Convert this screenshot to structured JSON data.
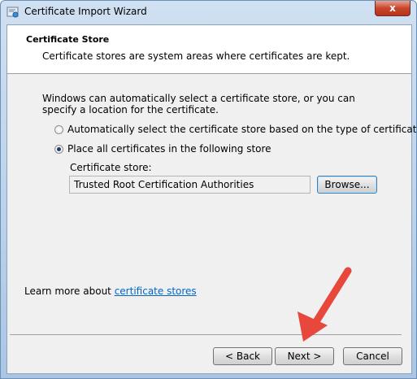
{
  "window": {
    "title": "Certificate Import Wizard",
    "close_glyph": "x"
  },
  "header": {
    "title": "Certificate Store",
    "subtitle": "Certificate stores are system areas where certificates are kept."
  },
  "body": {
    "intro": "Windows can automatically select a certificate store, or you can specify a location for the certificate.",
    "option_auto": "Automatically select the certificate store based on the type of certificate",
    "option_manual": "Place all certificates in the following store",
    "selected_option": "option_manual",
    "store_label": "Certificate store:",
    "store_value": "Trusted Root Certification Authorities",
    "browse_label": "Browse...",
    "learn_prefix": "Learn more about ",
    "learn_link": "certificate stores"
  },
  "footer": {
    "back_label": "< Back",
    "next_label": "Next >",
    "cancel_label": "Cancel"
  },
  "colors": {
    "link": "#0066cc",
    "annotation_arrow": "#e8473b"
  }
}
